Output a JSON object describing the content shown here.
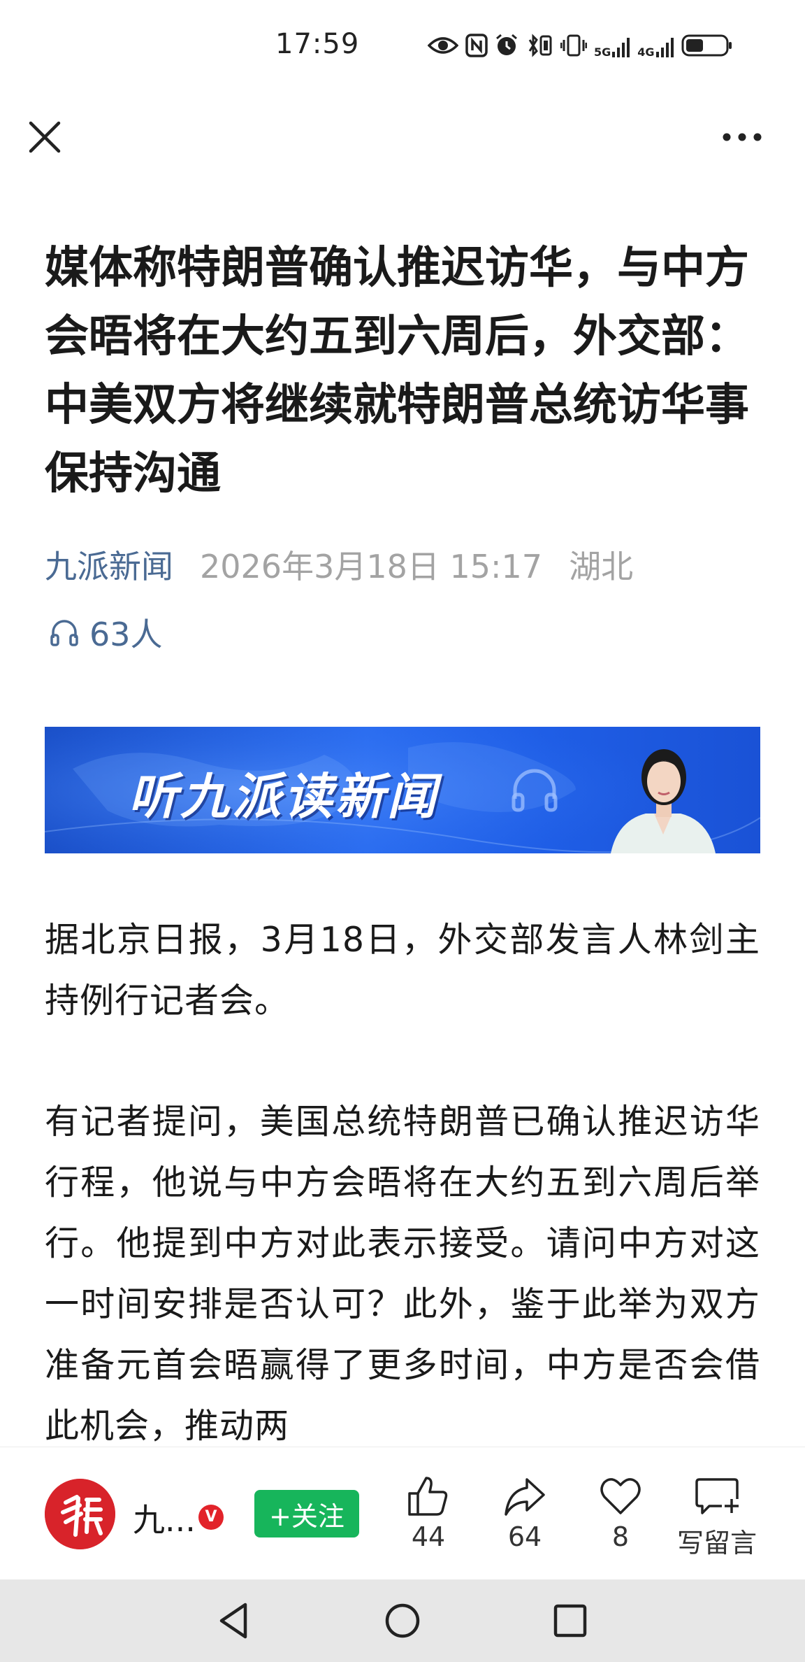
{
  "status_bar": {
    "time": "17:59",
    "icons": [
      "eye-icon",
      "nfc-icon",
      "alarm-icon",
      "bluetooth-vibrate-icon",
      "vibrate-icon",
      "signal-5g-icon",
      "signal-4g-icon",
      "battery-icon"
    ],
    "signal_5g_label": "5G",
    "signal_4g_label": "4G"
  },
  "nav": {
    "close_icon": "close-icon",
    "more_icon": "more-icon"
  },
  "article": {
    "headline": "媒体称特朗普确认推迟访华，与中方会晤将在大约五到六周后，外交部：中美双方将继续就特朗普总统访华事保持沟通",
    "source": "九派新闻",
    "date": "2026年3月18日 15:17",
    "region": "湖北",
    "listeners": "63人",
    "paragraphs": [
      "据北京日报，3月18日，外交部发言人林剑主持例行记者会。",
      "有记者提问，美国总统特朗普已确认推迟访华行程，他说与中方会晤将在大约五到六周后举行。他提到中方对此表示接受。请问中方对这一时间安排是否认可？此外，鉴于此举为双方准备元首会晤赢得了更多时间，中方是否会借此机会，推动两"
    ]
  },
  "banner": {
    "text": "听九派读新闻",
    "colors": {
      "bg_start": "#1a4fc7",
      "bg_end": "#1a52d6"
    }
  },
  "bottom_bar": {
    "author": "九...",
    "verified": "V",
    "follow_label": "+关注",
    "like_count": "44",
    "share_count": "64",
    "favorite_count": "8",
    "comment_label": "写留言"
  },
  "colors": {
    "source_blue": "#4a6a93",
    "meta_gray": "#a3a3a3",
    "follow_green": "#17b55b",
    "brand_red": "#d8232a"
  }
}
